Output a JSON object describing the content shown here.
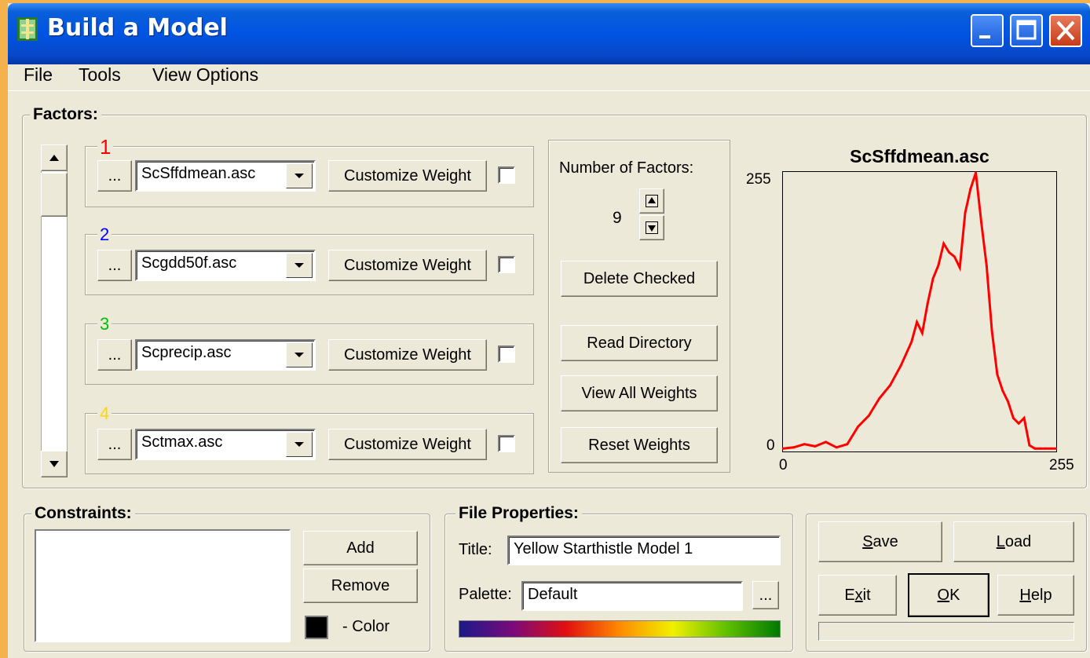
{
  "window": {
    "title": "Build a Model",
    "controls": [
      "minimize-icon",
      "maximize-icon",
      "close-icon"
    ]
  },
  "menu": [
    "File",
    "Tools",
    "View Options"
  ],
  "factors": {
    "label": "Factors:",
    "items": [
      {
        "number": "1",
        "color": "#ff0000",
        "file": "ScSffdmean.asc",
        "browse": "...",
        "weight_button": "Customize Weight",
        "checked": false
      },
      {
        "number": "2",
        "color": "#0000ff",
        "file": "Scgdd50f.asc",
        "browse": "...",
        "weight_button": "Customize Weight",
        "checked": false
      },
      {
        "number": "3",
        "color": "#00c000",
        "file": "Scprecip.asc",
        "browse": "...",
        "weight_button": "Customize Weight",
        "checked": false
      },
      {
        "number": "4",
        "color": "#ffd700",
        "file": "Sctmax.asc",
        "browse": "...",
        "weight_button": "Customize Weight",
        "checked": false
      }
    ],
    "number_label": "Number of Factors:",
    "count": "9",
    "delete_checked": "Delete Checked",
    "read_directory": "Read Directory",
    "view_all_weights": "View All Weights",
    "reset_weights": "Reset Weights"
  },
  "histogram": {
    "title": "ScSffdmean.asc",
    "y_max_label": "255",
    "y_min_label": "0",
    "x_min_label": "0",
    "x_max_label": "255",
    "color": "#ff0000"
  },
  "chart_data": {
    "type": "line",
    "title": "ScSffdmean.asc",
    "xlim": [
      0,
      255
    ],
    "ylim": [
      0,
      255
    ],
    "x": [
      0,
      10,
      20,
      30,
      40,
      50,
      60,
      70,
      80,
      90,
      100,
      110,
      120,
      125,
      130,
      135,
      140,
      145,
      150,
      155,
      160,
      165,
      170,
      175,
      180,
      185,
      190,
      195,
      200,
      205,
      210,
      215,
      220,
      225,
      230,
      235,
      240,
      245,
      250,
      255
    ],
    "series": [
      {
        "values": [
          2,
          3,
          6,
          4,
          8,
          3,
          6,
          22,
          32,
          48,
          60,
          78,
          100,
          118,
          108,
          135,
          158,
          170,
          190,
          182,
          178,
          168,
          218,
          240,
          255,
          210,
          170,
          110,
          70,
          55,
          45,
          30,
          25,
          30,
          5,
          2,
          2,
          2,
          2,
          2
        ]
      }
    ]
  },
  "constraints": {
    "label": "Constraints:",
    "add": "Add",
    "remove": "Remove",
    "color_label": "- Color",
    "swatch": "#000000"
  },
  "file_properties": {
    "label": "File Properties:",
    "title_label": "Title:",
    "title_value": "Yellow Starthistle Model 1",
    "palette_label": "Palette:",
    "palette_value": "Default",
    "browse": "...",
    "palette_colors": [
      "#1a1a8a",
      "#7a0a7a",
      "#e01010",
      "#ff8a00",
      "#f0f000",
      "#60c000",
      "#007a00"
    ]
  },
  "actions": {
    "save_mn": "S",
    "save_rest": "ave",
    "load_mn": "L",
    "load_rest": "oad",
    "exit_pre": "E",
    "exit_mn": "x",
    "exit_rest": "it",
    "ok_mn": "O",
    "ok_rest": "K",
    "help_mn": "H",
    "help_rest": "elp"
  },
  "colors": {
    "background": "#ece9d8",
    "titlebar": "#0054e3",
    "desktop": "#f3b24b"
  }
}
